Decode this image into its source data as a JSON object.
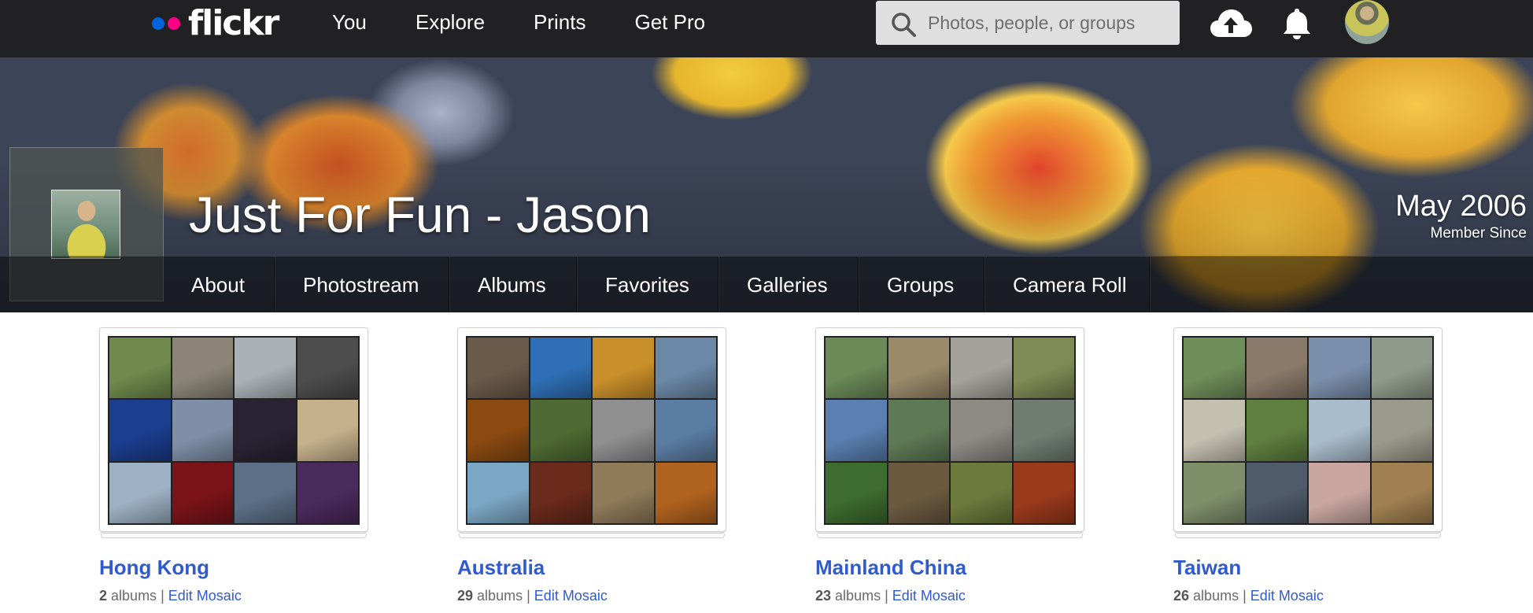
{
  "nav": {
    "logo_text": "flickr",
    "links": [
      "You",
      "Explore",
      "Prints",
      "Get Pro"
    ],
    "search_placeholder": "Photos, people, or groups",
    "icons": [
      "search-icon",
      "upload-cloud-icon",
      "bell-icon",
      "avatar"
    ]
  },
  "profile": {
    "name": "Just For Fun - Jason",
    "member_year": "May 2006",
    "member_since_label": "Member Since"
  },
  "subnav": [
    "About",
    "Photostream",
    "Albums",
    "Favorites",
    "Galleries",
    "Groups",
    "Camera Roll"
  ],
  "collections": [
    {
      "title": "Hong Kong",
      "count": "2",
      "albums_label": "albums",
      "separator": "|",
      "edit_label": "Edit Mosaic",
      "tiles": [
        "#6f8a4c",
        "#8c8577",
        "#a9b1b7",
        "#4d4d4d",
        "#1c3e8f",
        "#7f8fa8",
        "#2a2334",
        "#c6b08c",
        "#9db1c4",
        "#7a1418",
        "#5c6f87",
        "#4b2a5c"
      ]
    },
    {
      "title": "Australia",
      "count": "29",
      "albums_label": "albums",
      "separator": "|",
      "edit_label": "Edit Mosaic",
      "tiles": [
        "#6b5a4a",
        "#2f6fb5",
        "#c98f2a",
        "#6b88a6",
        "#8a4a12",
        "#4f6b33",
        "#8f8f8f",
        "#5b7da3",
        "#7ca7c4",
        "#6a2a1c",
        "#8f7a5a",
        "#b0621f"
      ]
    },
    {
      "title": "Mainland China",
      "count": "23",
      "albums_label": "albums",
      "separator": "|",
      "edit_label": "Edit Mosaic",
      "tiles": [
        "#6a8a58",
        "#9a8a6a",
        "#a4a29a",
        "#7f8a55",
        "#5a7fb0",
        "#5e7a55",
        "#8d8a84",
        "#6f7d72",
        "#3e6b2f",
        "#6b5a40",
        "#6c7a3c",
        "#9a3a1c"
      ]
    },
    {
      "title": "Taiwan",
      "count": "26",
      "albums_label": "albums",
      "separator": "|",
      "edit_label": "Edit Mosaic",
      "tiles": [
        "#6f8f5a",
        "#8a7a6a",
        "#7a8fab",
        "#8f9a8a",
        "#c4c0b0",
        "#5f7f3f",
        "#a9bccc",
        "#9a9a8c",
        "#7f8f6a",
        "#4f5a6a",
        "#c9a7a0",
        "#a08050"
      ]
    }
  ],
  "colors": {
    "topnav_bg": "#212124",
    "logo_blue": "#0063dc",
    "logo_pink": "#ff0084",
    "link_blue": "#2f5bcd"
  }
}
